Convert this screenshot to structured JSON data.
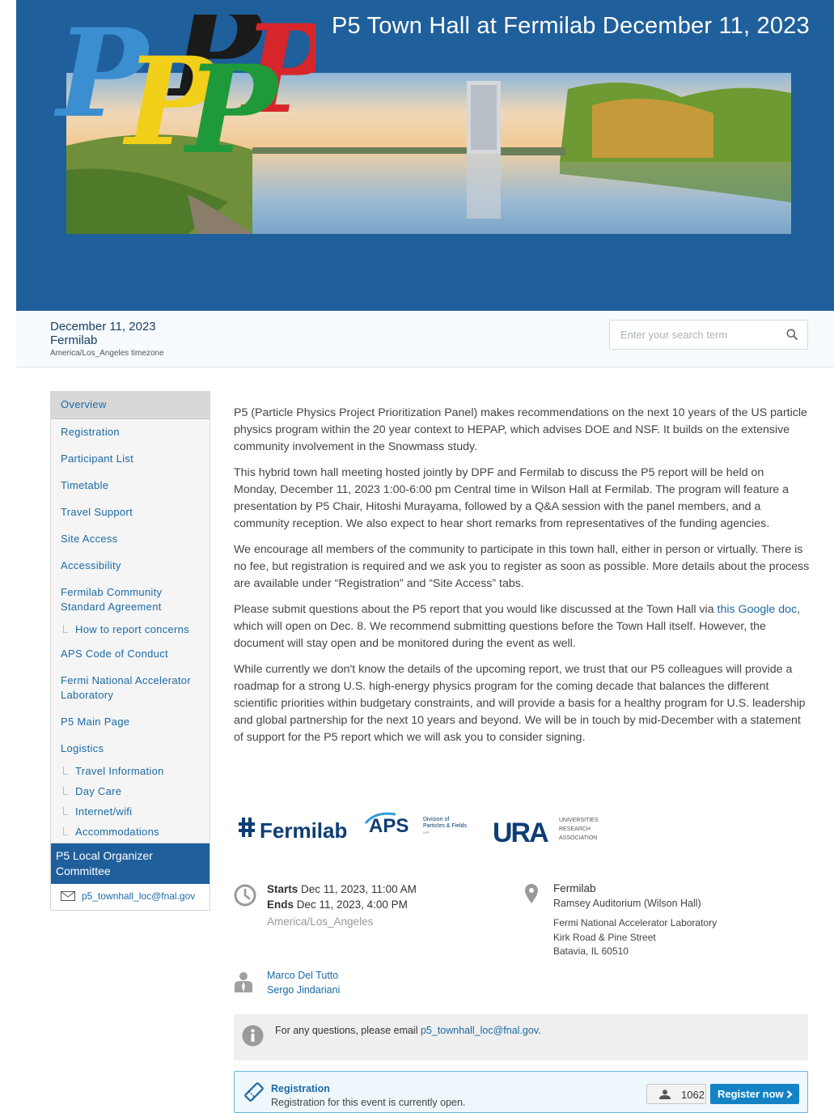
{
  "banner": {
    "title": "P5 Town Hall at Fermilab December 11, 2023"
  },
  "event_info": {
    "date": "December 11, 2023",
    "venue": "Fermilab",
    "timezone": "America/Los_Angeles timezone"
  },
  "search": {
    "placeholder": "Enter your search term"
  },
  "sidebar": {
    "items": [
      {
        "label": "Overview",
        "active": true
      },
      {
        "label": "Registration"
      },
      {
        "label": "Participant List"
      },
      {
        "label": "Timetable"
      },
      {
        "label": "Travel Support"
      },
      {
        "label": "Site Access"
      },
      {
        "label": "Accessibility"
      },
      {
        "label": "Fermilab Community Standard Agreement"
      },
      {
        "label": "How to report concerns",
        "sub": true
      },
      {
        "label": "APS Code of Conduct"
      },
      {
        "label": "Fermi National Accelerator Laboratory"
      },
      {
        "label": "P5 Main Page"
      },
      {
        "label": "Logistics"
      },
      {
        "label": "Travel Information",
        "sub": true
      },
      {
        "label": "Day Care",
        "sub": true
      },
      {
        "label": "Internet/wifi",
        "sub": true
      },
      {
        "label": "Accommodations",
        "sub": true
      }
    ]
  },
  "organizer_box": {
    "title": "P5 Local Organizer Committee",
    "email": "p5_townhall_loc@fnal.gov"
  },
  "content": {
    "para1": "P5 (Particle Physics Project Prioritization Panel) makes recommendations on the next 10 years of the US particle physics program within the 20 year context to HEPAP, which advises DOE and NSF. It builds on the extensive community involvement in the Snowmass study.",
    "para2": "This hybrid town hall meeting hosted jointly by DPF and Fermilab to discuss the P5 report will be held on Monday, December  11, 2023 1:00-6:00 pm Central time in Wilson Hall at Fermilab. The program will feature a presentation by P5 Chair, Hitoshi Murayama, followed by a Q&A session with the panel members, and a community reception. We also expect to hear short remarks from representatives of the funding agencies.",
    "para3": "We encourage all members of the community to participate in this town hall, either in person or virtually. There is no fee, but registration is required and we ask you to register as soon as possible. More details about the process are available under “Registration” and “Site Access” tabs.",
    "para4_before": "Please submit questions about the P5 report that you would like discussed at the Town Hall via ",
    "para4_link": "this Google doc",
    "para4_after": ", which will open on Dec. 8. We recommend submitting questions before the Town Hall itself. However, the document will stay open and be monitored during the event as well.",
    "para5": "While currently we don't know the details of the upcoming report, we trust that our P5 colleagues will provide a roadmap for a strong U.S. high-energy physics program for the coming decade that balances the different scientific priorities within budgetary constraints, and will provide a basis for a healthy program for U.S. leadership and global partnership for the next 10 years and beyond. We will be in touch by mid-December with a statement of support for the P5 report which we will ask you to consider signing."
  },
  "logos": {
    "fermilab": "Fermilab",
    "aps": "APS",
    "aps_division_line1": "Division of",
    "aps_division_line2": "Particles & Fields",
    "aps_dpf": "DPF",
    "ura": "URA",
    "ura_line1": "UNIVERSITIES",
    "ura_line2": "RESEARCH",
    "ura_line3": "ASSOCIATION"
  },
  "when": {
    "starts_label": "Starts",
    "starts_value": "Dec 11, 2023, 11:00 AM",
    "ends_label": "Ends",
    "ends_value": "Dec 11, 2023, 4:00 PM",
    "timezone": "America/Los_Angeles"
  },
  "where": {
    "name": "Fermilab",
    "room": "Ramsey Auditorium (Wilson Hall)",
    "address_line1": "Fermi National Accelerator Laboratory",
    "address_line2": "Kirk Road & Pine Street",
    "address_line3": "Batavia, IL 60510"
  },
  "chairs": [
    "Marco Del Tutto",
    "Sergo Jindariani"
  ],
  "notice": {
    "text": "For any questions, please email ",
    "email": "p5_townhall_loc@fnal.gov",
    "suffix": "."
  },
  "registration": {
    "title": "Registration",
    "subtitle": "Registration for this event is currently open.",
    "count": "1062",
    "button_label": "Register now"
  },
  "colors": {
    "banner": "#1f5f9b",
    "link": "#1b6aa5",
    "button": "#1383c5"
  }
}
